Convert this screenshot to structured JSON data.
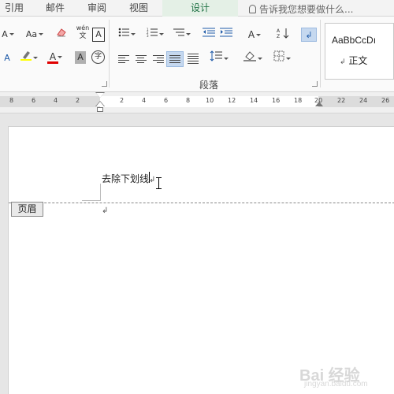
{
  "tabs": [
    "引用",
    "邮件",
    "审阅",
    "视图",
    "设计"
  ],
  "active_tab": "设计",
  "tell_me": "告诉我您想要做什么...",
  "ribbon": {
    "font_size_grow": "A",
    "change_case": "Aa",
    "phonetic": "wén",
    "phonetic_sub": "文",
    "char_border": "A",
    "font_color": "A",
    "char_shading": "A",
    "enclose_char": "字",
    "asian_layout": "A",
    "paragraph_label": "段落",
    "style_preview": "AaBbCcDı",
    "style_name": "正文",
    "style_mark": "↲"
  },
  "ruler": {
    "numbers": [
      "8",
      "6",
      "4",
      "2",
      "2",
      "4",
      "6",
      "8",
      "10",
      "12",
      "14",
      "16",
      "18",
      "20",
      "22",
      "24",
      "26"
    ]
  },
  "document": {
    "header_text": "去除下划线",
    "paragraph_mark": "↲",
    "header_tag": "页眉"
  },
  "watermark": {
    "text": "Bai 经验",
    "sub": "jingyan.baidu.com"
  },
  "colors": {
    "accent_tab": "#217346",
    "highlight_yellow": "#ffff00",
    "font_red": "#e00000"
  }
}
